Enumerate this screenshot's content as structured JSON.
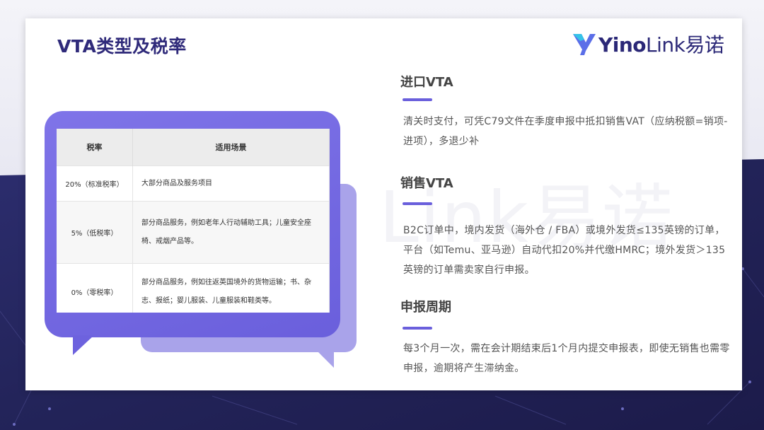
{
  "page": {
    "title": "VTA类型及税率"
  },
  "logo": {
    "brand_bold": "Yino",
    "brand_light": "Link",
    "brand_cn": "易诺",
    "watermark": "Link易诺",
    "accent_color": "#2b2877"
  },
  "table": {
    "headers": [
      "税率",
      "适用场景"
    ],
    "rows": [
      {
        "rate": "20%（标准税率）",
        "scene": "大部分商品及服务项目"
      },
      {
        "rate": "5%（低税率）",
        "scene": "部分商品服务，例如老年人行动辅助工具；儿童安全座椅、戒烟产品等。"
      },
      {
        "rate": "0%（零税率）",
        "scene": "部分商品服务，例如往返英国境外的货物运输；书、杂志、报纸；婴儿服装、儿童服装和鞋类等。"
      }
    ]
  },
  "sections": [
    {
      "title": "进口VTA",
      "text": "清关时支付，可凭C79文件在季度申报中抵扣销售VAT（应纳税额=销项-进项），多退少补"
    },
    {
      "title": "销售VTA",
      "text": "B2C订单中，境内发货（海外仓 / FBA）或境外发货≤135英镑的订单，平台（如Temu、亚马逊）自动代扣20%并代缴HMRC；境外发货＞135英镑的订单需卖家自行申报。"
    },
    {
      "title": "申报周期",
      "text": "每3个月一次，需在会计期结束后1个月内提交申报表，即使无销售也需零申报，逾期将产生滞纳金。"
    }
  ],
  "colors": {
    "accent": "#6a5fdc",
    "title": "#2f2a7a",
    "background_dark": "#23245a"
  }
}
